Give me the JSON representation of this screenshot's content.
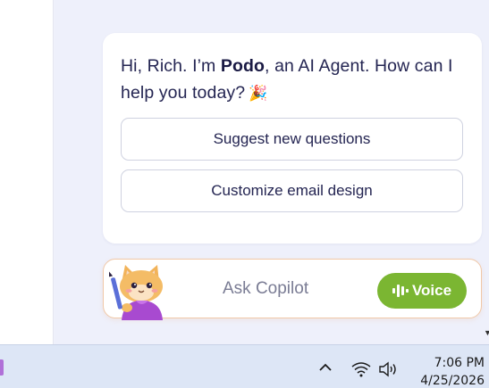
{
  "chat": {
    "greeting_prefix": "Hi, Rich. I’m ",
    "agent_name": "Podo",
    "greeting_suffix": ", an AI Agent. How can I help you today?",
    "greeting_emoji": "🎉",
    "suggestions": [
      "Suggest new questions",
      "Customize email design"
    ]
  },
  "input": {
    "placeholder": "Ask Copilot",
    "voice_label": "Voice",
    "accent_color": "#7bb632"
  },
  "taskbar": {
    "time": "7:06 PM",
    "date": "4/25/2026",
    "icons": [
      "chevron-up-icon",
      "wifi-icon",
      "volume-icon"
    ]
  }
}
